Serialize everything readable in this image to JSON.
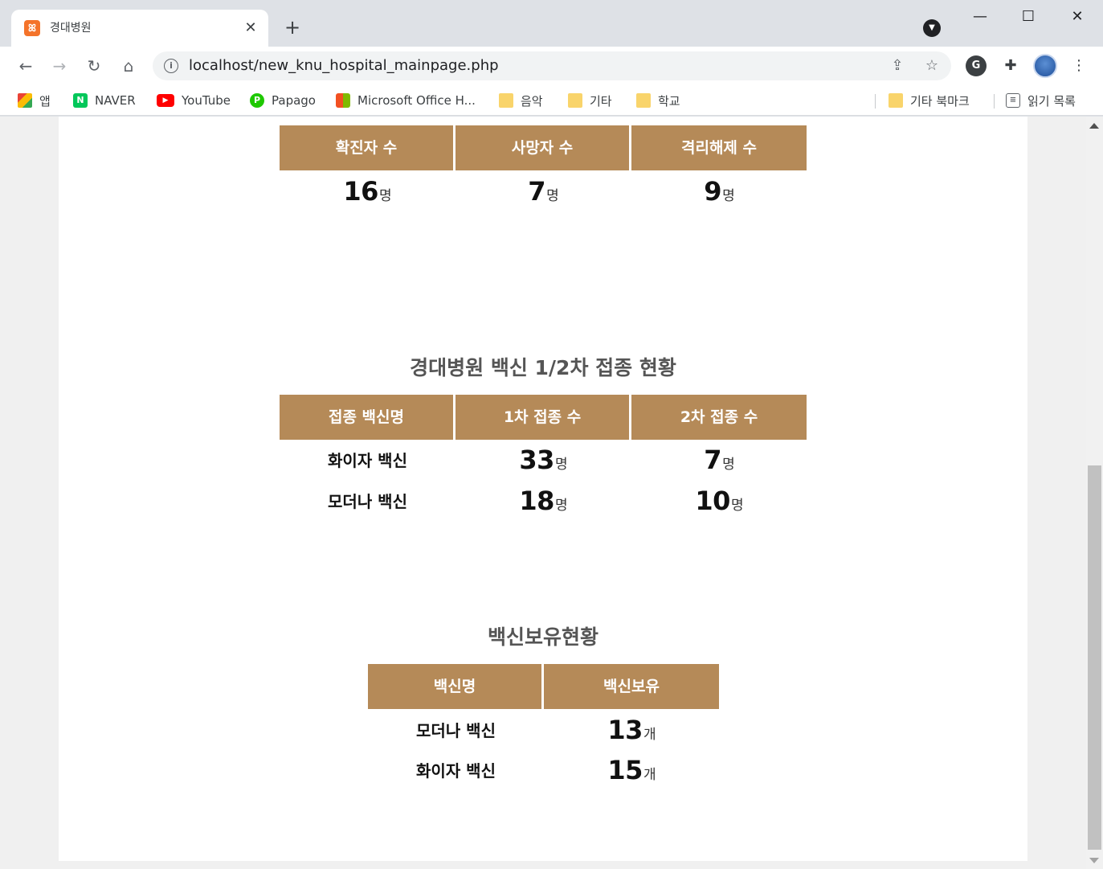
{
  "browser": {
    "tab_title": "경대병원",
    "tab_favicon": "ꕤ",
    "new_tab_label": "+",
    "tab_close_label": "✕",
    "url": "localhost/new_knu_hospital_mainpage.php",
    "window": {
      "minimize": "—",
      "maximize": "☐",
      "close": "✕"
    },
    "nav": {
      "back": "←",
      "forward": "→",
      "reload": "↻",
      "home": "⌂"
    },
    "bookmarks": [
      {
        "label": "앱",
        "icon": "apps-grid-icon"
      },
      {
        "label": "NAVER",
        "icon": "naver-icon"
      },
      {
        "label": "YouTube",
        "icon": "youtube-icon"
      },
      {
        "label": "Papago",
        "icon": "papago-icon"
      },
      {
        "label": "Microsoft Office H...",
        "icon": "microsoft-icon"
      },
      {
        "label": "음악",
        "icon": "folder-icon"
      },
      {
        "label": "기타",
        "icon": "folder-icon"
      },
      {
        "label": "학교",
        "icon": "folder-icon"
      }
    ],
    "other_bookmarks": "기타 북마크",
    "reading_list": "읽기 목록",
    "colors": {
      "frame": "#dee1e6",
      "toolbar": "#ffffff"
    }
  },
  "page": {
    "colors": {
      "header_bg": "#b58a58",
      "header_text": "#ffffff",
      "title_text": "#555555"
    },
    "covid": {
      "headers": [
        "확진자 수",
        "사망자 수",
        "격리해제 수"
      ],
      "values": [
        {
          "value": "16",
          "unit": "명"
        },
        {
          "value": "7",
          "unit": "명"
        },
        {
          "value": "9",
          "unit": "명"
        }
      ]
    },
    "vaccination": {
      "title": "경대병원 백신 1/2차 접종 현황",
      "headers": [
        "접종 백신명",
        "1차 접종 수",
        "2차 접종 수"
      ],
      "rows": [
        {
          "name": "화이자 백신",
          "first": "33",
          "first_unit": "명",
          "second": "7",
          "second_unit": "명"
        },
        {
          "name": "모더나 백신",
          "first": "18",
          "first_unit": "명",
          "second": "10",
          "second_unit": "명"
        }
      ]
    },
    "stock": {
      "title": "백신보유현황",
      "headers": [
        "백신명",
        "백신보유"
      ],
      "rows": [
        {
          "name": "모더나 백신",
          "count": "13",
          "unit": "개"
        },
        {
          "name": "화이자 백신",
          "count": "15",
          "unit": "개"
        }
      ]
    }
  }
}
